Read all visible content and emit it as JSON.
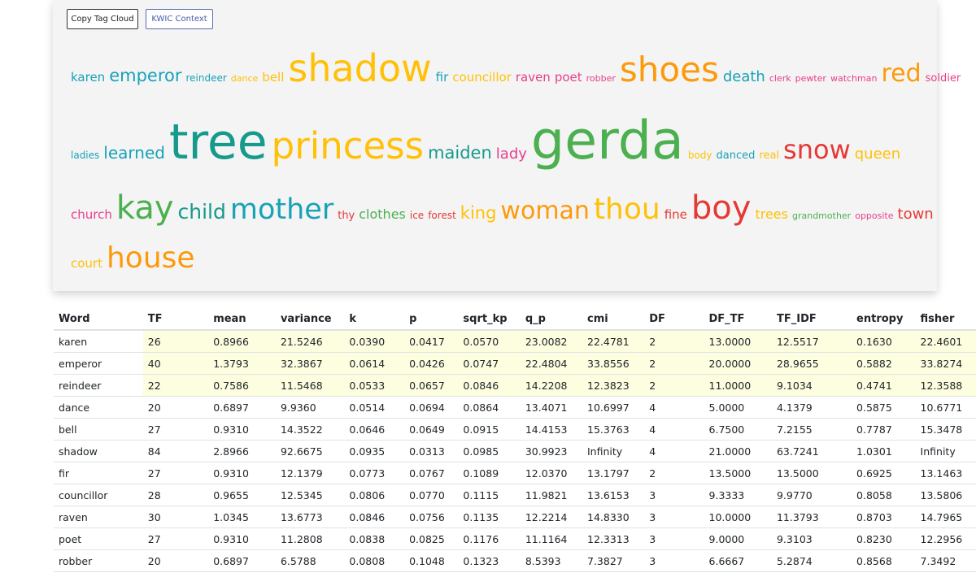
{
  "toolbar": {
    "copy_label": "Copy Tag Cloud",
    "kwic_label": "KWIC Context"
  },
  "cloud": {
    "lines": [
      [
        {
          "text": "karen",
          "size": 15,
          "color": "#17a2b8"
        },
        {
          "text": "emperor",
          "size": 21,
          "color": "#17a2b8"
        },
        {
          "text": "reindeer",
          "size": 12,
          "color": "#17a2b8"
        },
        {
          "text": "dance",
          "size": 11,
          "color": "#ffc107"
        },
        {
          "text": "bell",
          "size": 15,
          "color": "#ffc107"
        },
        {
          "text": "shadow",
          "size": 46,
          "color": "#ffc107"
        },
        {
          "text": "fir",
          "size": 15,
          "color": "#17a2b8"
        },
        {
          "text": "councillor",
          "size": 15,
          "color": "#ffc107"
        },
        {
          "text": "raven",
          "size": 15,
          "color": "#e83e8c"
        },
        {
          "text": "poet",
          "size": 15,
          "color": "#e83e8c"
        },
        {
          "text": "robber",
          "size": 11,
          "color": "#e83e8c"
        },
        {
          "text": "shoes",
          "size": 42,
          "color": "#fd9a0b"
        },
        {
          "text": "death",
          "size": 18,
          "color": "#17a2b8"
        },
        {
          "text": "clerk",
          "size": 11,
          "color": "#e83e8c"
        },
        {
          "text": "pewter",
          "size": 11,
          "color": "#e83e8c"
        },
        {
          "text": "watchman",
          "size": 11,
          "color": "#e83e8c"
        },
        {
          "text": "red",
          "size": 30,
          "color": "#fd9a0b"
        },
        {
          "text": "soldier",
          "size": 13,
          "color": "#e83e8c"
        }
      ],
      [
        {
          "text": "ladies",
          "size": 12,
          "color": "#17a2b8"
        },
        {
          "text": "learned",
          "size": 20,
          "color": "#17a2b8"
        },
        {
          "text": "tree",
          "size": 60,
          "color": "#159a8c"
        },
        {
          "text": "princess",
          "size": 45,
          "color": "#ffc107"
        },
        {
          "text": "maiden",
          "size": 21,
          "color": "#159a8c"
        },
        {
          "text": "lady",
          "size": 18,
          "color": "#e83e8c"
        },
        {
          "text": "gerda",
          "size": 65,
          "color": "#4caf50"
        },
        {
          "text": "body",
          "size": 12,
          "color": "#ffc107"
        },
        {
          "text": "danced",
          "size": 13,
          "color": "#17a2b8"
        },
        {
          "text": "real",
          "size": 13,
          "color": "#ffc107"
        },
        {
          "text": "snow",
          "size": 32,
          "color": "#e53935"
        },
        {
          "text": "queen",
          "size": 18,
          "color": "#ffc107"
        }
      ],
      [
        {
          "text": "church",
          "size": 15,
          "color": "#e83e8c"
        },
        {
          "text": "kay",
          "size": 40,
          "color": "#4caf50"
        },
        {
          "text": "child",
          "size": 25,
          "color": "#159a8c"
        },
        {
          "text": "mother",
          "size": 35,
          "color": "#17a2b8"
        },
        {
          "text": "thy",
          "size": 13,
          "color": "#e53935"
        },
        {
          "text": "clothes",
          "size": 16,
          "color": "#4caf50"
        },
        {
          "text": "ice",
          "size": 12,
          "color": "#e53935"
        },
        {
          "text": "forest",
          "size": 12,
          "color": "#e53935"
        },
        {
          "text": "king",
          "size": 21,
          "color": "#ffc107"
        },
        {
          "text": "woman",
          "size": 30,
          "color": "#fd9a0b"
        },
        {
          "text": "thou",
          "size": 36,
          "color": "#ffc107"
        },
        {
          "text": "fine",
          "size": 15,
          "color": "#e53935"
        },
        {
          "text": "boy",
          "size": 40,
          "color": "#e53935"
        },
        {
          "text": "trees",
          "size": 16,
          "color": "#ffc107"
        },
        {
          "text": "grandmother",
          "size": 11,
          "color": "#4caf50"
        },
        {
          "text": "opposite",
          "size": 11,
          "color": "#e83e8c"
        },
        {
          "text": "town",
          "size": 18,
          "color": "#e53935"
        }
      ],
      [
        {
          "text": "court",
          "size": 15,
          "color": "#ffc107"
        },
        {
          "text": "house",
          "size": 36,
          "color": "#fd9a0b"
        }
      ]
    ]
  },
  "table": {
    "headers": [
      "Word",
      "TF",
      "mean",
      "variance",
      "k",
      "p",
      "sqrt_kp",
      "q_p",
      "cmi",
      "DF",
      "DF_TF",
      "TF_IDF",
      "entropy",
      "fisher"
    ],
    "rows": [
      [
        "karen",
        "26",
        "0.8966",
        "21.5246",
        "0.0390",
        "0.0417",
        "0.0570",
        "23.0082",
        "22.4781",
        "2",
        "13.0000",
        "12.5517",
        "0.1630",
        "22.4601"
      ],
      [
        "emperor",
        "40",
        "1.3793",
        "32.3867",
        "0.0614",
        "0.0426",
        "0.0747",
        "22.4804",
        "33.8556",
        "2",
        "20.0000",
        "28.9655",
        "0.5882",
        "33.8274"
      ],
      [
        "reindeer",
        "22",
        "0.7586",
        "11.5468",
        "0.0533",
        "0.0657",
        "0.0846",
        "14.2208",
        "12.3823",
        "2",
        "11.0000",
        "9.1034",
        "0.4741",
        "12.3588"
      ],
      [
        "dance",
        "20",
        "0.6897",
        "9.9360",
        "0.0514",
        "0.0694",
        "0.0864",
        "13.4071",
        "10.6997",
        "4",
        "5.0000",
        "4.1379",
        "0.5875",
        "10.6771"
      ],
      [
        "bell",
        "27",
        "0.9310",
        "14.3522",
        "0.0646",
        "0.0649",
        "0.0915",
        "14.4153",
        "15.3763",
        "4",
        "6.7500",
        "7.2155",
        "0.7787",
        "15.3478"
      ],
      [
        "shadow",
        "84",
        "2.8966",
        "92.6675",
        "0.0935",
        "0.0313",
        "0.0985",
        "30.9923",
        "Infinity",
        "4",
        "21.0000",
        "63.7241",
        "1.0301",
        "Infinity"
      ],
      [
        "fir",
        "27",
        "0.9310",
        "12.1379",
        "0.0773",
        "0.0767",
        "0.1089",
        "12.0370",
        "13.1797",
        "2",
        "13.5000",
        "13.5000",
        "0.6925",
        "13.1463"
      ],
      [
        "councillor",
        "28",
        "0.9655",
        "12.5345",
        "0.0806",
        "0.0770",
        "0.1115",
        "11.9821",
        "13.6153",
        "3",
        "9.3333",
        "9.9770",
        "0.8058",
        "13.5806"
      ],
      [
        "raven",
        "30",
        "1.0345",
        "13.6773",
        "0.0846",
        "0.0756",
        "0.1135",
        "12.2214",
        "14.8330",
        "3",
        "10.0000",
        "11.3793",
        "0.8703",
        "14.7965"
      ],
      [
        "poet",
        "27",
        "0.9310",
        "11.2808",
        "0.0838",
        "0.0825",
        "0.1176",
        "11.1164",
        "12.3313",
        "3",
        "9.0000",
        "9.3103",
        "0.8230",
        "12.2956"
      ],
      [
        "robber",
        "20",
        "0.6897",
        "6.5788",
        "0.0808",
        "0.1048",
        "0.1323",
        "8.5393",
        "7.3827",
        "3",
        "6.6667",
        "5.2874",
        "0.8568",
        "7.3492"
      ]
    ],
    "highlighted_row_count": 3
  }
}
